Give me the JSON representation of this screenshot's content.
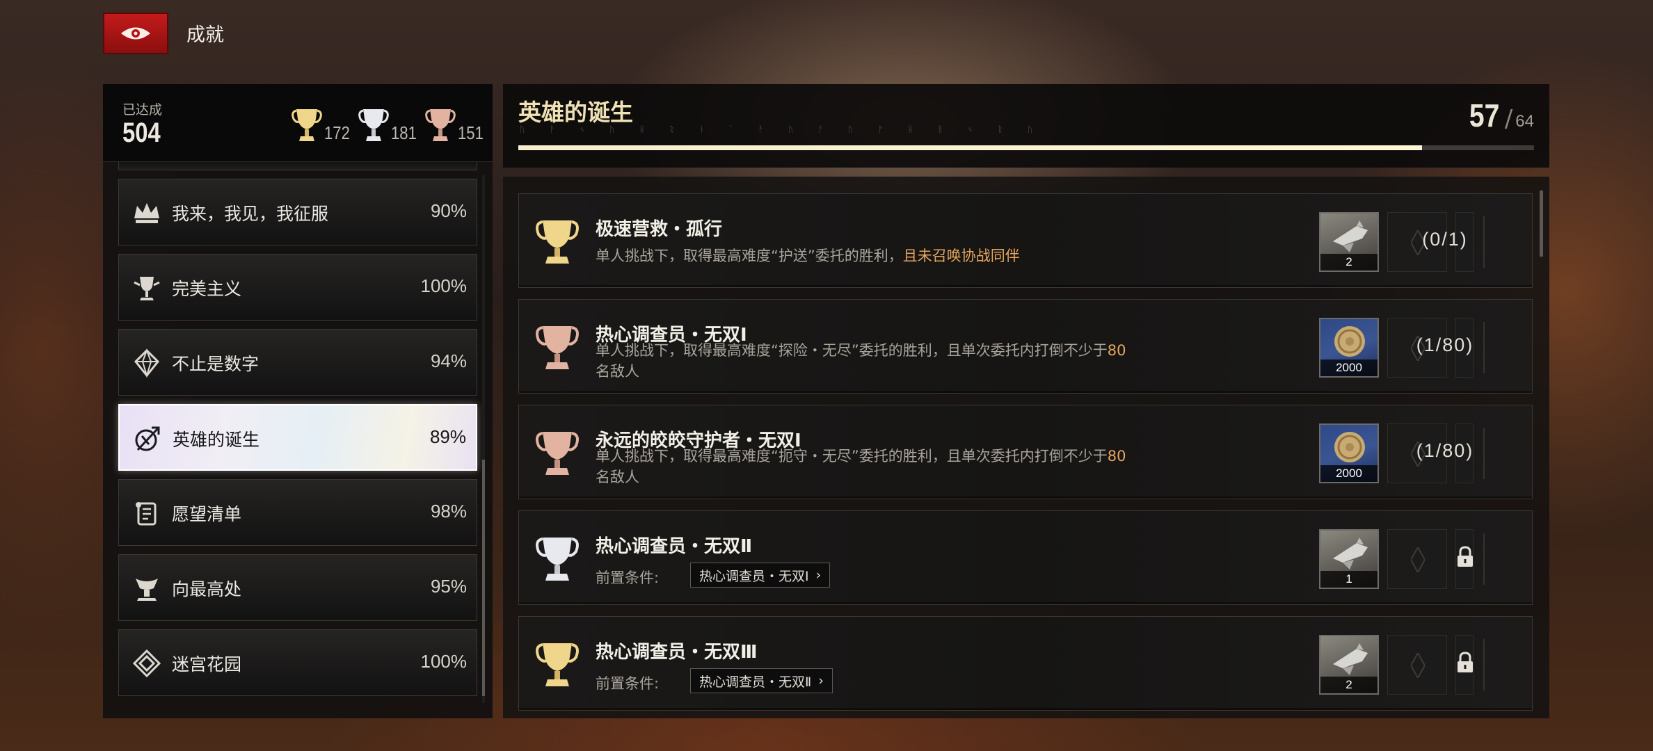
{
  "header": {
    "title": "成就",
    "logo_icon": "faction-emblem-icon"
  },
  "summary": {
    "label": "已达成",
    "count": "504",
    "gold": "172",
    "silver": "181",
    "bronze": "151"
  },
  "categories": [
    {
      "name": "我来，我见，我征服",
      "pct": "90%",
      "icon": "crown-icon"
    },
    {
      "name": "完美主义",
      "pct": "100%",
      "icon": "goblet-icon"
    },
    {
      "name": "不止是数字",
      "pct": "94%",
      "icon": "diamond-icon"
    },
    {
      "name": "英雄的诞生",
      "pct": "89%",
      "icon": "hero-emblem-icon",
      "active": true
    },
    {
      "name": "愿望清单",
      "pct": "98%",
      "icon": "scroll-icon"
    },
    {
      "name": "向最高处",
      "pct": "95%",
      "icon": "summit-icon"
    },
    {
      "name": "迷宫花园",
      "pct": "100%",
      "icon": "maze-icon"
    }
  ],
  "detail": {
    "title": "英雄的诞生",
    "rune": "ᚢ ᚨ ᛃ ᚢ ᚺ ᚱ ᚾ ` ᚨ ᚢ ᚨ ᚢ ᚡ ᚺ ᚱ ᛃ ᚱ ᚢ",
    "progress_current": "57",
    "progress_sep": "/",
    "progress_total": "64",
    "progress_ratio": 0.89
  },
  "achievements": [
    {
      "tier": "gold",
      "name": "极速营救・孤行",
      "desc": "单人挑战下，取得最高难度“护送”委托的胜利，",
      "desc_highlight": "且未召唤协战同伴",
      "desc_tail": "",
      "reward_type": "silver-bg",
      "reward_icon": "spaceship-icon",
      "reward_count": "2",
      "progress": "(0/1)",
      "locked": false
    },
    {
      "tier": "bronze",
      "name": "热心调查员・无双Ⅰ",
      "desc": "单人挑战下，取得最高难度“探险・无尽”委托的胜利，且单次委托内打倒不少于",
      "desc_highlight": "80",
      "desc_tail": "名敌人",
      "reward_type": "blue-bg",
      "reward_icon": "gold-coin-icon",
      "reward_count": "2000",
      "progress": "(1/80)",
      "locked": false
    },
    {
      "tier": "bronze",
      "name": "永远的皎皎守护者・无双Ⅰ",
      "desc": "单人挑战下，取得最高难度“扼守・无尽”委托的胜利，且单次委托内打倒不少于",
      "desc_highlight": "80",
      "desc_tail": "名敌人",
      "reward_type": "blue-bg",
      "reward_icon": "gold-coin-icon",
      "reward_count": "2000",
      "progress": "(1/80)",
      "locked": false
    },
    {
      "tier": "silver",
      "name": "热心调查员・无双Ⅱ",
      "prereq_label": "前置条件:",
      "prereq": "热心调查员・无双Ⅰ",
      "reward_type": "silver-bg",
      "reward_icon": "spaceship-icon",
      "reward_count": "1",
      "locked": true
    },
    {
      "tier": "gold",
      "name": "热心调查员・无双Ⅲ",
      "prereq_label": "前置条件:",
      "prereq": "热心调查员・无双Ⅱ",
      "reward_type": "silver-bg",
      "reward_icon": "spaceship-icon",
      "reward_count": "2",
      "locked": true
    }
  ],
  "colors": {
    "gold": "#f0d68a",
    "silver": "#e7e9ee",
    "bronze": "#e2b3a0",
    "highlight": "#e8a65e",
    "progress_fill": "#f6eed0"
  }
}
